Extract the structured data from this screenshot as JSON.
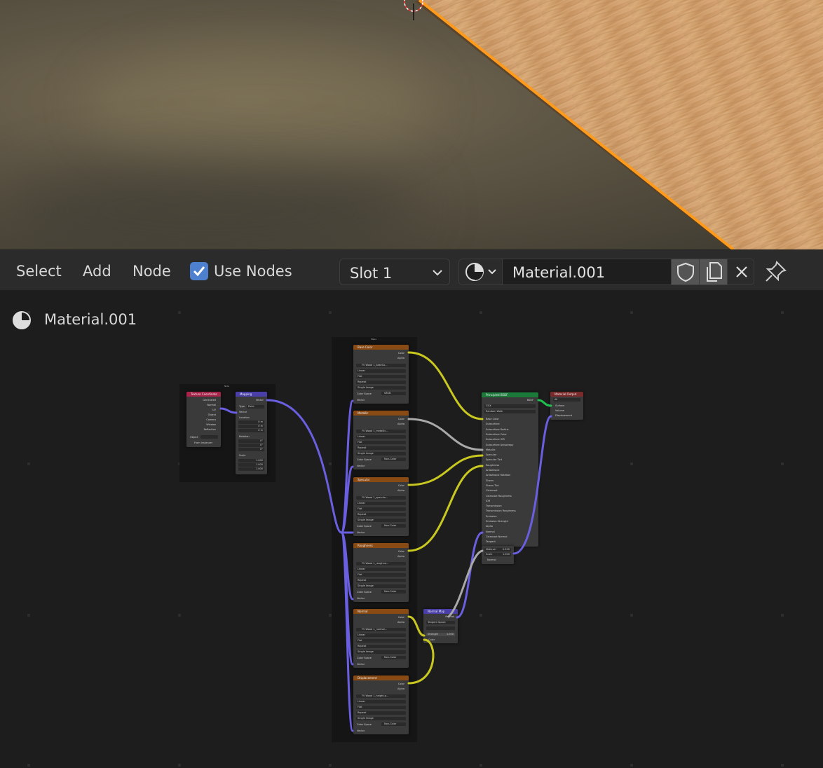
{
  "header": {
    "menu": [
      "Select",
      "Add",
      "Node"
    ],
    "use_nodes_label": "Use Nodes",
    "use_nodes_checked": true,
    "slot_label": "Slot 1",
    "material_name": "Material.001"
  },
  "breadcrumb": {
    "label": "Material.001"
  },
  "colors": {
    "accent_blue": "#4d80ce",
    "selection_orange": "#ff9a1a",
    "texture_header": "#8a4a14",
    "shader_header": "#1b7a3a",
    "output_header": "#7a2a2a",
    "vector_header": "#4a3fa8",
    "input_header": "#a8234a"
  },
  "icons": {
    "material": "material-sphere-icon",
    "shield": "fake-user-shield-icon",
    "duplicate": "duplicate-icon",
    "close": "close-icon",
    "pin": "pin-icon",
    "chevron": "chevron-down-icon",
    "check": "checkmark-icon"
  },
  "nodes": {
    "frame_left_label": "Note",
    "frame_right_label": "Maps",
    "texcoord": {
      "title": "Texture Coordinate",
      "outputs": [
        "Generated",
        "Normal",
        "UV",
        "Object",
        "Camera",
        "Window",
        "Reflection"
      ],
      "object_label": "Object",
      "instancer_label": "From Instancer"
    },
    "mapping": {
      "title": "Mapping",
      "output": "Vector",
      "type_label": "Type",
      "type_value": "Point",
      "vector": "Vector",
      "location": "Location",
      "rotation": "Rotation",
      "scale": "Scale",
      "loc": [
        "0 m",
        "0 m",
        "0 m"
      ],
      "rot": [
        "0°",
        "0°",
        "0°"
      ],
      "scl": [
        "1.000",
        "1.000",
        "1.000"
      ]
    },
    "textures": [
      {
        "title": "Base Color",
        "file": "FV Wood 1_baseCo...",
        "space": "sRGB"
      },
      {
        "title": "Metallic",
        "file": "FV Wood 1_metallic...",
        "space": "Non-Color"
      },
      {
        "title": "Specular",
        "file": "FV Wood 1_specula...",
        "space": "Non-Color"
      },
      {
        "title": "Roughness",
        "file": "FV Wood 1_roughne...",
        "space": "Non-Color"
      },
      {
        "title": "Normal",
        "file": "FV Wood 1_normal...",
        "space": "Non-Color"
      },
      {
        "title": "Displacement",
        "file": "FV Wood 1_height.p...",
        "space": "Non-Color"
      }
    ],
    "tex_common": {
      "color": "Color",
      "alpha": "Alpha",
      "interp": "Linear",
      "proj": "Flat",
      "ext": "Repeat",
      "src": "Single Image",
      "cs": "Color Space",
      "vector": "Vector"
    },
    "bsdf": {
      "title": "Principled BSDF",
      "out": "BSDF",
      "dist": "GGX",
      "sss": "Random Walk",
      "rows": [
        "Base Color",
        "Subsurface",
        "Subsurface Radius",
        "Subsurface Color",
        "Subsurface IOR",
        "Subsurface Anisotropy",
        "Metallic",
        "Specular",
        "Specular Tint",
        "Roughness",
        "Anisotropic",
        "Anisotropic Rotation",
        "Sheen",
        "Sheen Tint",
        "Clearcoat",
        "Clearcoat Roughness",
        "IOR",
        "Transmission",
        "Transmission Roughness",
        "Emission",
        "Emission Strength",
        "Alpha",
        "Normal",
        "Clearcoat Normal",
        "Tangent"
      ]
    },
    "output": {
      "title": "Material Output",
      "target": "All",
      "inputs": [
        "Surface",
        "Volume",
        "Displacement"
      ]
    },
    "normalmap": {
      "title": "Normal Map",
      "out": "Normal",
      "space": "Tangent Space",
      "strength": "Strength",
      "strength_val": "1.000",
      "color": "Color"
    },
    "disp": {
      "mid": "Midlevel",
      "mid_val": "0.500",
      "scale": "Scale",
      "scale_val": "1.000",
      "normal": "Normal"
    }
  }
}
